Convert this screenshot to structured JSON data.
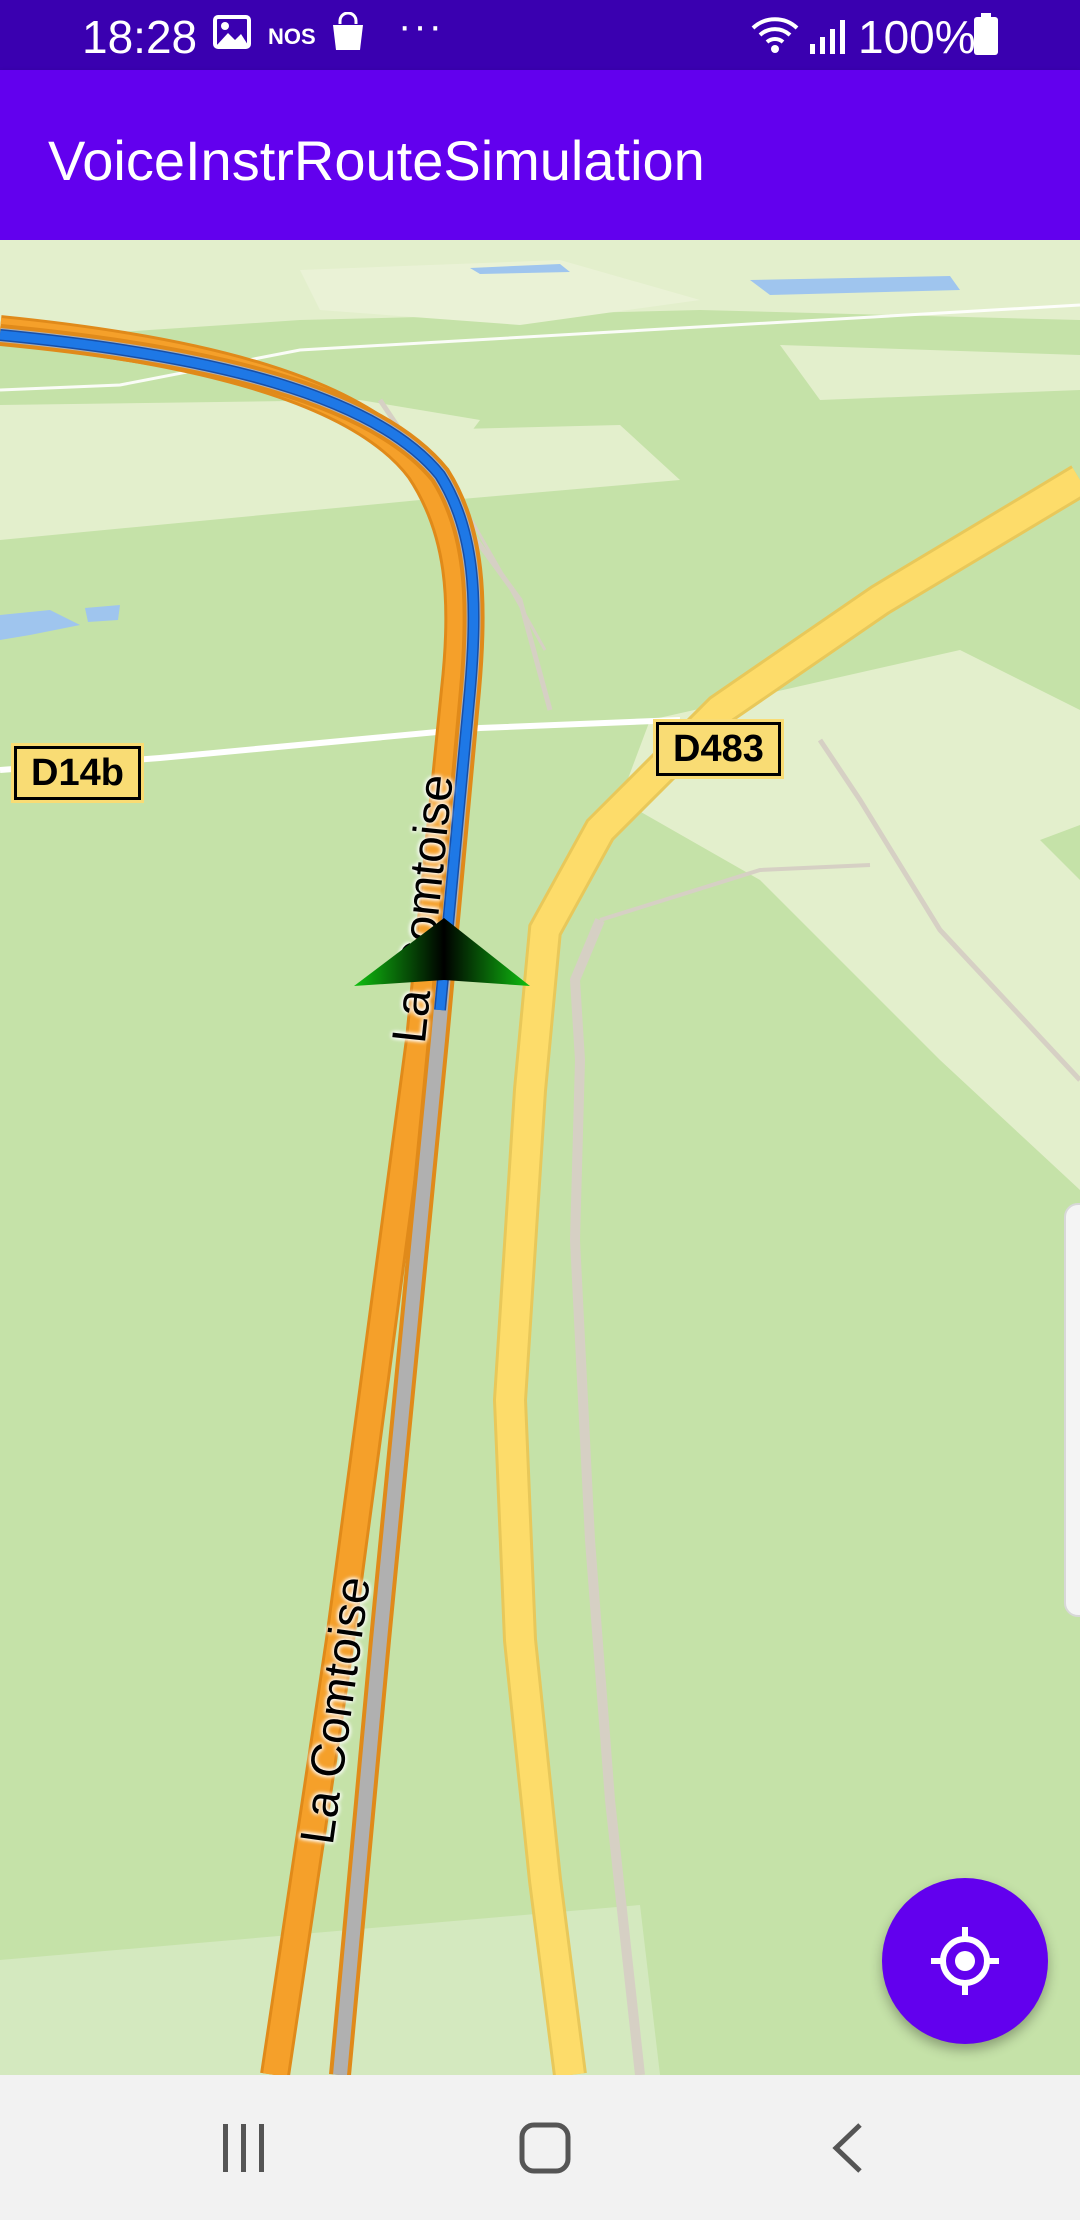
{
  "status_bar": {
    "time": "18:28",
    "carrier_label": "NOS",
    "more_indicator": "···",
    "battery_percent": "100%",
    "icons": [
      "gallery-icon",
      "shopping-bag-icon",
      "wifi-icon",
      "signal-icon",
      "battery-icon"
    ]
  },
  "app_bar": {
    "title": "VoiceInstrRouteSimulation"
  },
  "map": {
    "road_shields": [
      "D14b",
      "D483"
    ],
    "street_labels": [
      "La Comtoise",
      "La Comtoise"
    ],
    "route_color": "#1e78e6",
    "highway_color": "#f5a02a",
    "secondary_road_color": "#fddc6a",
    "vehicle_marker": "navigation-arrow-icon"
  },
  "fab": {
    "icon": "my-location-icon",
    "color": "#6200ee"
  },
  "nav_bar": {
    "buttons": [
      "recent-apps-icon",
      "home-icon",
      "back-icon"
    ]
  }
}
